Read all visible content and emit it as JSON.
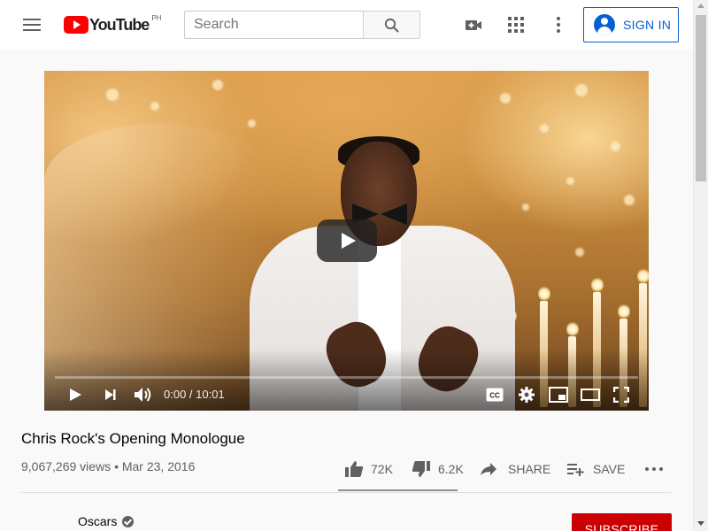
{
  "header": {
    "logo_text": "YouTube",
    "country_code": "PH",
    "search_placeholder": "Search",
    "sign_in_label": "SIGN IN"
  },
  "player": {
    "current_time": "0:00",
    "duration": "10:01",
    "time_display": "0:00 / 10:01",
    "progress_fraction": 0.0,
    "captions_label": "CC"
  },
  "video": {
    "title": "Chris Rock's Opening Monologue",
    "views": "9,067,269 views",
    "date": "Mar 23, 2016",
    "meta_text": "9,067,269 views • Mar 23, 2016"
  },
  "actions": {
    "likes": "72K",
    "dislikes": "6.2K",
    "share_label": "SHARE",
    "save_label": "SAVE"
  },
  "channel": {
    "name": "Oscars",
    "subscribe_label": "SUBSCRIBE"
  },
  "colors": {
    "brand_red": "#ff0000",
    "link_blue": "#065fd4",
    "subscribe_red": "#cc0000"
  }
}
